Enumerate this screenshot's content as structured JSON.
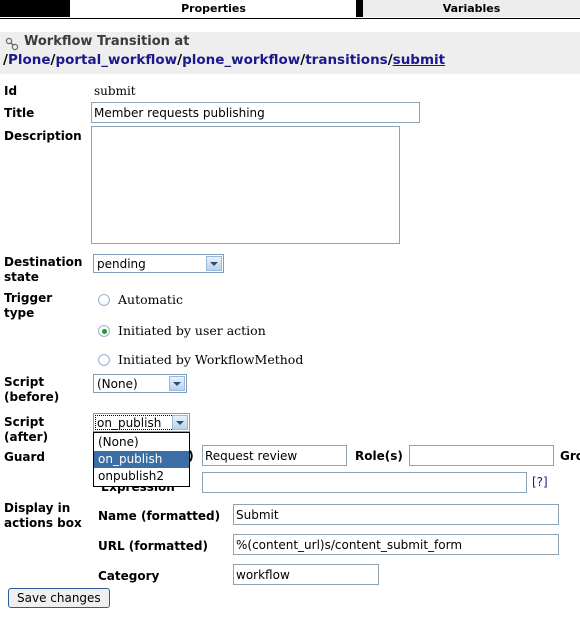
{
  "tabs": [
    {
      "label": "",
      "state": "blank"
    },
    {
      "label": "Properties",
      "state": "selected"
    },
    {
      "label": "Variables",
      "state": "unselected"
    }
  ],
  "header": {
    "icon": "chain-link-icon",
    "title": "Workflow Transition at",
    "path_segments": [
      "Plone",
      "portal_workflow",
      "plone_workflow",
      "transitions"
    ],
    "path_current": "submit",
    "path_full": "/Plone/portal_workflow/plone_workflow/transitions/submit"
  },
  "form": {
    "id": {
      "label": "Id",
      "value": "submit"
    },
    "title": {
      "label": "Title",
      "value": "Member requests publishing"
    },
    "description": {
      "label": "Description",
      "value": ""
    },
    "destination_state": {
      "label": "Destination state",
      "value": "pending"
    },
    "trigger_type": {
      "label": "Trigger type",
      "options": [
        {
          "label": "Automatic",
          "checked": false
        },
        {
          "label": "Initiated by user action",
          "checked": true
        },
        {
          "label": "Initiated by WorkflowMethod",
          "checked": false
        }
      ]
    },
    "script_before": {
      "label": "Script (before)",
      "value": "(None)"
    },
    "script_after": {
      "label": "Script (after)",
      "value": "on_publish",
      "open": true,
      "focused": true,
      "options": [
        {
          "label": "(None)",
          "selected": false
        },
        {
          "label": "on_publish",
          "selected": true
        },
        {
          "label": "onpublish2",
          "selected": false
        }
      ]
    },
    "guard": {
      "label": "Guard",
      "permissions_label": "Permission(s)",
      "permissions_value": "Request review",
      "roles_label": "Role(s)",
      "roles_value": "",
      "groups_label": "Gro",
      "expression_label": "Expression",
      "expression_value": "",
      "help_link": "[?]"
    },
    "display_actions": {
      "label": "Display in actions box",
      "fields": [
        {
          "label": "Name (formatted)",
          "value": "Submit"
        },
        {
          "label": "URL (formatted)",
          "value": "%(content_url)s/content_submit_form"
        },
        {
          "label": "Category",
          "value": "workflow"
        }
      ]
    },
    "save_button": "Save changes"
  },
  "colors": {
    "link": "#1a1a8c",
    "header_bg": "#eeeeee",
    "input_border": "#8ca3b5",
    "highlight": "#3a6ea5",
    "radio_dot": "#1f9d1f"
  }
}
